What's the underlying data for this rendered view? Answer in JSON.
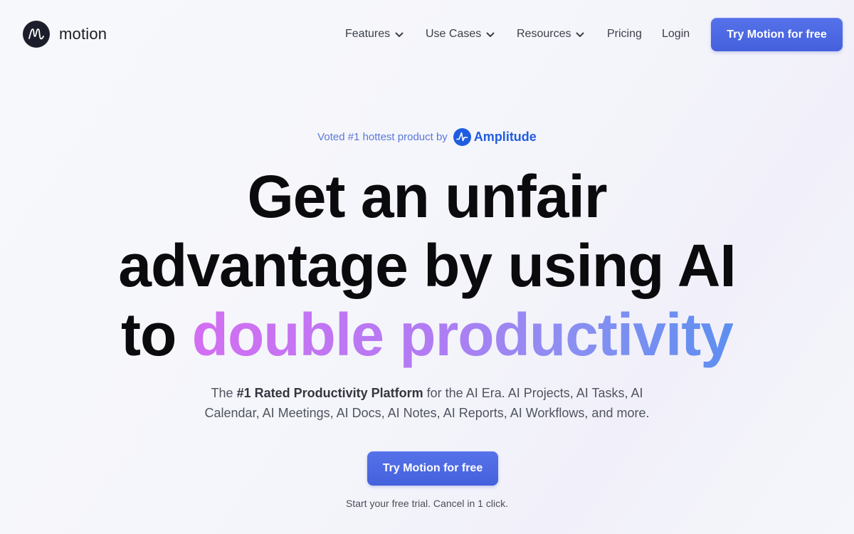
{
  "brand": {
    "name": "motion"
  },
  "nav": {
    "items": [
      {
        "label": "Features",
        "has_dropdown": true
      },
      {
        "label": "Use Cases",
        "has_dropdown": true
      },
      {
        "label": "Resources",
        "has_dropdown": true
      },
      {
        "label": "Pricing",
        "has_dropdown": false
      },
      {
        "label": "Login",
        "has_dropdown": false
      }
    ],
    "cta_label": "Try Motion for free"
  },
  "hero": {
    "voted_text": "Voted #1 hottest product by",
    "voted_brand": "Amplitude",
    "headline_line1": "Get an unfair",
    "headline_line2": "advantage by using AI",
    "headline_line3_prefix": "to",
    "headline_line3_highlight": "double productivity",
    "sub_prefix": "The",
    "sub_bold": "#1 Rated Productivity Platform",
    "sub_line1_rest": "for the AI Era. AI Projects, AI Tasks, AI",
    "sub_line2": "Calendar, AI Meetings, AI Docs, AI Notes, AI Reports, AI Workflows, and more.",
    "cta_label": "Try Motion for free",
    "trial_text": "Start your free trial. Cancel in 1 click."
  },
  "colors": {
    "accent": "#4a66e0",
    "amplitude_blue": "#1f5de0",
    "gradient_start": "#d46ef2",
    "gradient_end": "#5c8ff0"
  },
  "icons": [
    "motion-logo-icon",
    "chevron-down-icon",
    "amplitude-logo-icon"
  ]
}
